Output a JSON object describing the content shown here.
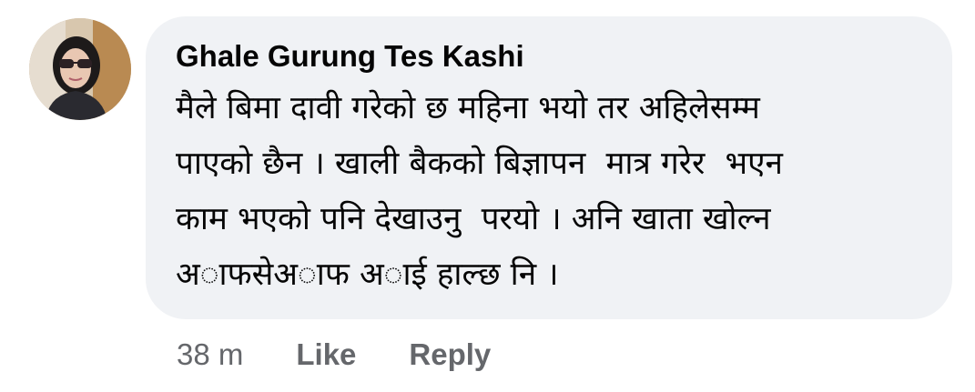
{
  "comment": {
    "author": "Ghale Gurung Tes Kashi",
    "text_lines": [
      "मैले बिमा दावी गरेको छ महिना भयो तर अहिलेसम्म",
      "पाएको छैन । खाली बैकको बिज्ञापन  मात्र गरेर  भएन",
      "काम भएको पनि देखाउनु  परयो । अनि खाता खोल्न",
      "अाफसेअाफ अाई हाल्छ नि ।"
    ],
    "timestamp": "38 m",
    "like_label": "Like",
    "reply_label": "Reply"
  },
  "avatar": {
    "icon": "profile-photo",
    "background_color": "#cdb9a0"
  },
  "colors": {
    "bubble": "#f0f2f5",
    "text": "#050505",
    "meta": "#65676b"
  }
}
